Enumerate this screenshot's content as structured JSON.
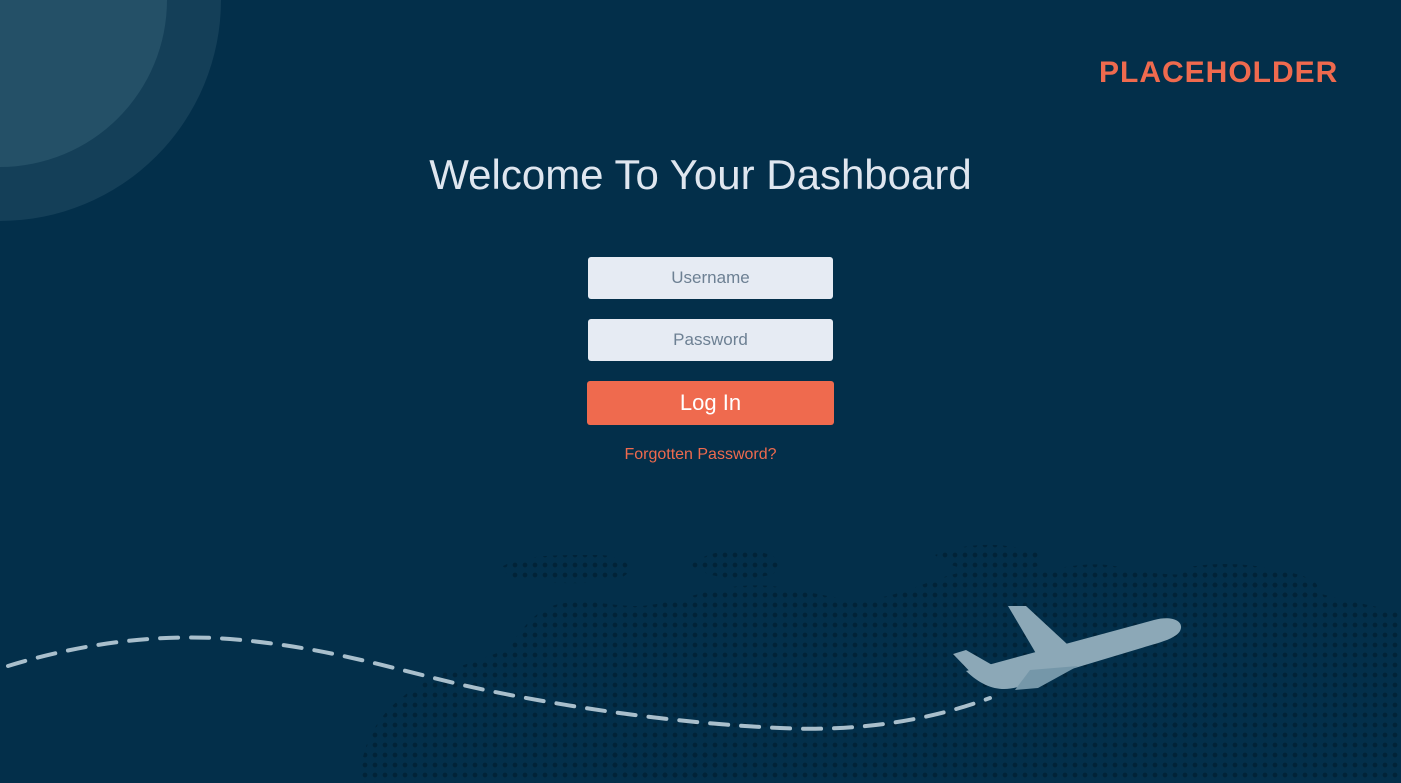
{
  "brand": {
    "logo_text": "PLACEHOLDER",
    "accent_color": "#ef6a4e",
    "background_color": "#032f4a"
  },
  "page": {
    "title": "Welcome To Your Dashboard"
  },
  "login_form": {
    "username_placeholder": "Username",
    "password_placeholder": "Password",
    "submit_label": "Log In",
    "forgot_password_label": "Forgotten Password?"
  },
  "decorations": {
    "background_art": "dotted-world-map",
    "airplane_icon": "airplane-icon",
    "flight_path": "dashed-flight-path"
  }
}
